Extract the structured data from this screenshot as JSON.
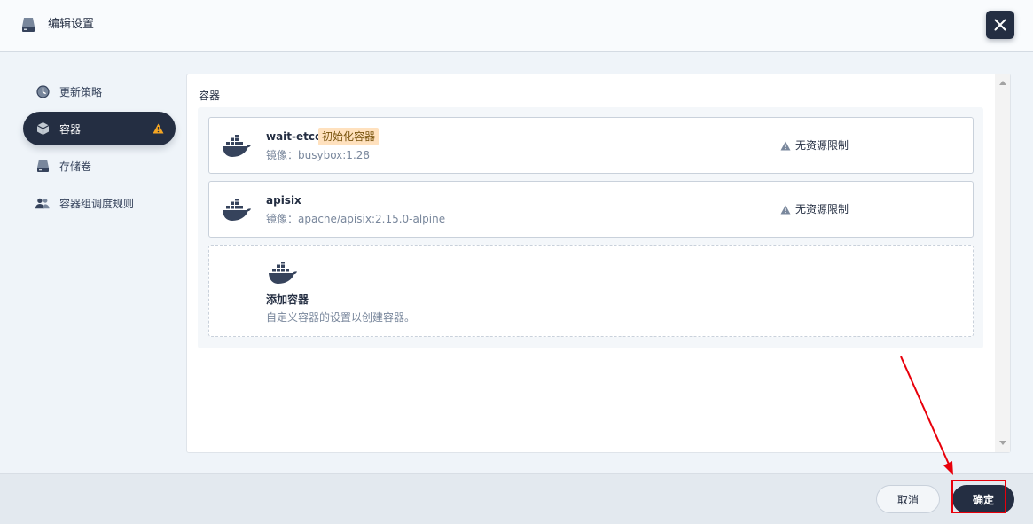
{
  "header": {
    "title": "编辑设置",
    "icon": "disk-icon"
  },
  "sidebar": {
    "items": [
      {
        "label": "更新策略",
        "icon": "clock-icon",
        "active": false
      },
      {
        "label": "容器",
        "icon": "cube-icon",
        "active": true,
        "warning": true
      },
      {
        "label": "存储卷",
        "icon": "volume-icon",
        "active": false
      },
      {
        "label": "容器组调度规则",
        "icon": "users-icon",
        "active": false
      }
    ]
  },
  "panel": {
    "title": "容器",
    "containers": [
      {
        "name": "wait-etcd",
        "tag": "初始化容器",
        "image": "镜像：busybox:1.28",
        "resource": "无资源限制"
      },
      {
        "name": "apisix",
        "tag": "",
        "image": "镜像：apache/apisix:2.15.0-alpine",
        "resource": "无资源限制"
      }
    ],
    "add": {
      "title": "添加容器",
      "desc": "自定义容器的设置以创建容器。"
    }
  },
  "footer": {
    "cancel": "取消",
    "ok": "确定"
  },
  "colors": {
    "primary": "#242e42",
    "tag_bg": "#ffe1be",
    "annotation": "#e8000b",
    "background": "#eff4f9"
  }
}
